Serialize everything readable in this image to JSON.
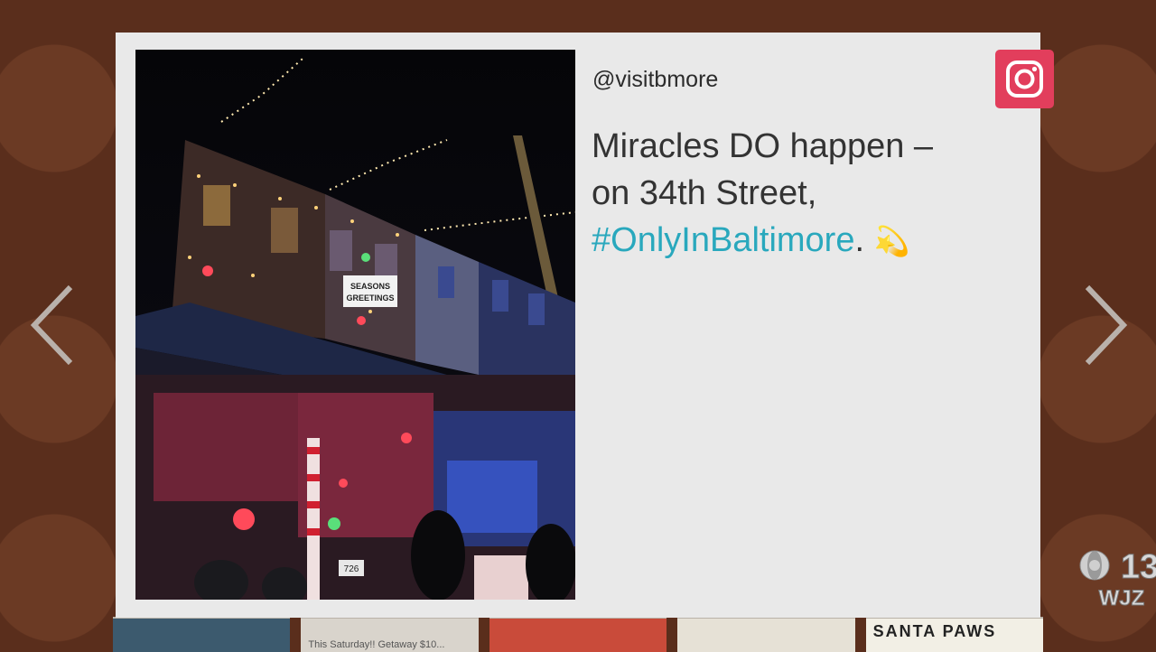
{
  "post": {
    "handle": "@visitbmore",
    "caption_line1": "Miracles DO happen –",
    "caption_line2": "on 34th Street,",
    "hashtag": "#OnlyInBaltimore",
    "caption_end": ".",
    "emoji": "💫",
    "photo_sign_text": "SEASONS GREETINGS",
    "photo_house_number": "726"
  },
  "platform": {
    "icon": "instagram-icon",
    "color": "#e23e5c"
  },
  "nav": {
    "prev_icon": "chevron-left-icon",
    "next_icon": "chevron-right-icon"
  },
  "broadcaster": {
    "line1": "13",
    "line2": "WJZ"
  },
  "thumbnails": [
    {
      "text": ""
    },
    {
      "text": "This Saturday!! Getaway $10..."
    },
    {
      "text": ""
    },
    {
      "text": ""
    },
    {
      "text": "SANTA PAWS"
    }
  ],
  "colors": {
    "hashtag": "#29a8bd",
    "card": "#e9e9e9",
    "background": "#5a2e1c"
  }
}
